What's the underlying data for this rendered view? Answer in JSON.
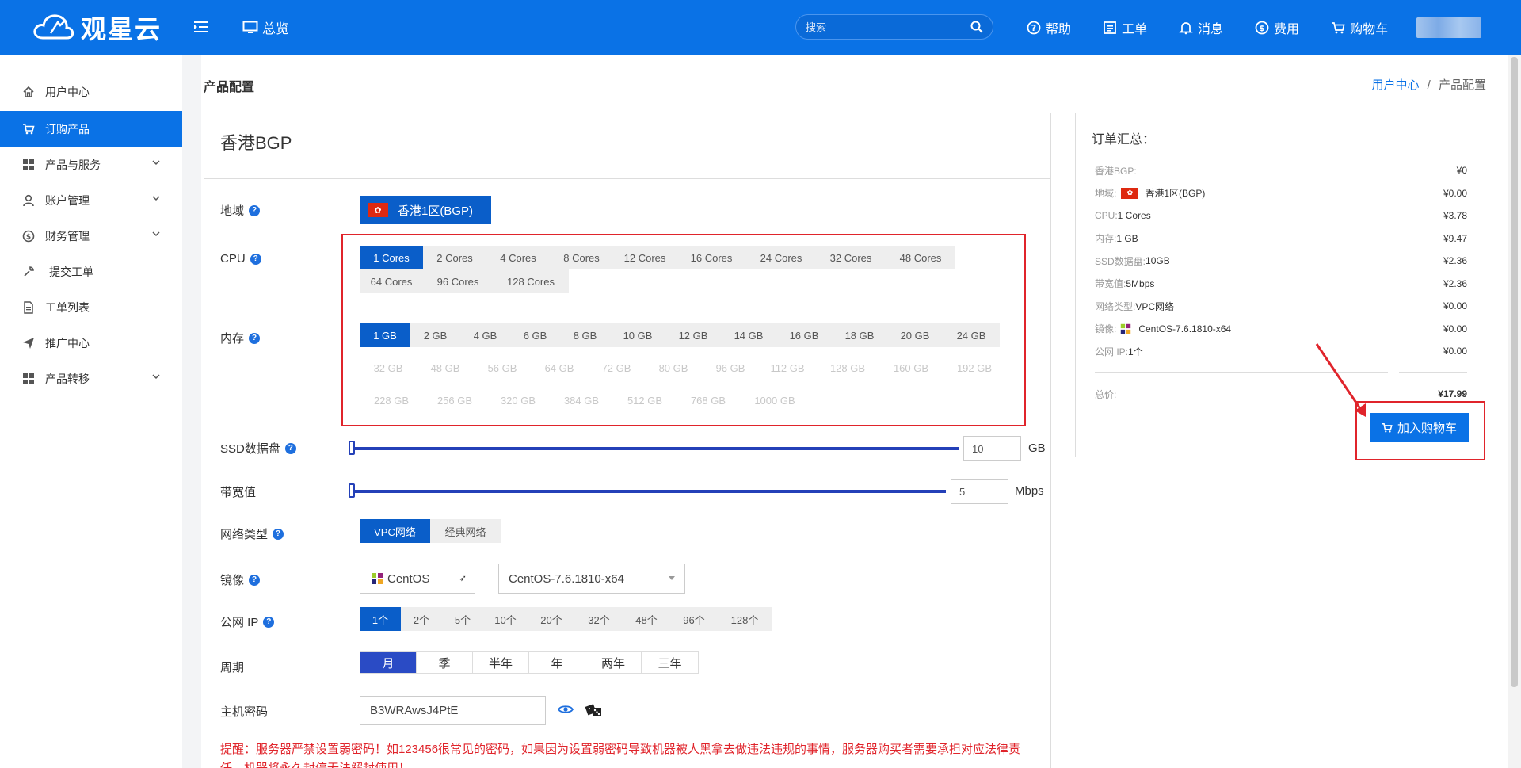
{
  "header": {
    "logo_text": "观星云",
    "overview_label": "总览",
    "search_placeholder": "搜索",
    "nav": [
      {
        "label": "帮助",
        "icon": "help-icon"
      },
      {
        "label": "工单",
        "icon": "ticket-icon"
      },
      {
        "label": "消息",
        "icon": "bell-icon"
      },
      {
        "label": "费用",
        "icon": "dollar-icon"
      },
      {
        "label": "购物车",
        "icon": "cart-icon"
      }
    ]
  },
  "sidebar": {
    "items": [
      {
        "label": "用户中心",
        "icon": "home-icon"
      },
      {
        "label": "订购产品",
        "icon": "cart-icon",
        "active": true
      },
      {
        "label": "产品与服务",
        "icon": "grid-icon",
        "expandable": true
      },
      {
        "label": "账户管理",
        "icon": "user-icon",
        "expandable": true
      },
      {
        "label": "财务管理",
        "icon": "dollar-icon",
        "expandable": true
      },
      {
        "label": "提交工单",
        "icon": "wrench-icon"
      },
      {
        "label": "工单列表",
        "icon": "document-icon"
      },
      {
        "label": "推广中心",
        "icon": "send-icon"
      },
      {
        "label": "产品转移",
        "icon": "grid-icon",
        "expandable": true
      }
    ]
  },
  "page": {
    "title": "产品配置",
    "breadcrumb": [
      "用户中心",
      "产品配置"
    ],
    "breadcrumb_sep": "/"
  },
  "config": {
    "product_name": "香港BGP",
    "labels": {
      "region": "地域",
      "cpu": "CPU",
      "memory": "内存",
      "ssd": "SSD数据盘",
      "bandwidth": "带宽值",
      "network": "网络类型",
      "image": "镜像",
      "public_ip": "公网 IP",
      "period": "周期",
      "password": "主机密码"
    },
    "region_value": "香港1区(BGP)",
    "flag_glyph": "✿",
    "cpu_options": [
      "1 Cores",
      "2 Cores",
      "4 Cores",
      "8 Cores",
      "12 Cores",
      "16 Cores",
      "24 Cores",
      "32 Cores",
      "48 Cores",
      "64 Cores",
      "96 Cores",
      "128 Cores"
    ],
    "cpu_selected": 0,
    "memory_options": [
      "1 GB",
      "2 GB",
      "4 GB",
      "6 GB",
      "8 GB",
      "10 GB",
      "12 GB",
      "14 GB",
      "16 GB",
      "18 GB",
      "20 GB",
      "24 GB"
    ],
    "memory_selected": 0,
    "memory_disabled_options": [
      "32 GB",
      "48 GB",
      "56 GB",
      "64 GB",
      "72 GB",
      "80 GB",
      "96 GB",
      "112 GB",
      "128 GB",
      "160 GB",
      "192 GB",
      "228 GB",
      "256 GB",
      "320 GB",
      "384 GB",
      "512 GB",
      "768 GB",
      "1000 GB"
    ],
    "ssd_value": "10",
    "ssd_unit": "GB",
    "bandwidth_value": "5",
    "bandwidth_unit": "Mbps",
    "network_options": [
      "VPC网络",
      "经典网络"
    ],
    "network_selected": 0,
    "image_os": "CentOS",
    "image_version": "CentOS-7.6.1810-x64",
    "ip_options": [
      "1个",
      "2个",
      "5个",
      "10个",
      "20个",
      "32个",
      "48个",
      "96个",
      "128个"
    ],
    "ip_selected": 0,
    "period_options": [
      "月",
      "季",
      "半年",
      "年",
      "两年",
      "三年"
    ],
    "period_selected": 0,
    "password_value": "B3WRAwsJ4PtE",
    "warning": "提醒：服务器严禁设置弱密码！如123456很常见的密码，如果因为设置弱密码导致机器被人黑拿去做违法违规的事情，服务器购买者需要承担对应法律责任，机器将永久封停无法解封使用！"
  },
  "summary": {
    "title": "订单汇总：",
    "rows": [
      {
        "key": "香港BGP:",
        "value": "",
        "price": "¥0"
      },
      {
        "key": "地域:",
        "value": "香港1区(BGP)",
        "price": "¥0.00",
        "flag": true
      },
      {
        "key": "CPU:",
        "value": "1 Cores",
        "price": "¥3.78"
      },
      {
        "key": "内存:",
        "value": "1 GB",
        "price": "¥9.47"
      },
      {
        "key": "SSD数据盘:",
        "value": "10GB",
        "price": "¥2.36"
      },
      {
        "key": "带宽值:",
        "value": "5Mbps",
        "price": "¥2.36"
      },
      {
        "key": "网络类型:",
        "value": "VPC网络",
        "price": "¥0.00"
      },
      {
        "key": "镜像:",
        "value": "CentOS-7.6.1810-x64",
        "price": "¥0.00",
        "os_icon": true
      },
      {
        "key": "公网 IP:",
        "value": "1个",
        "price": "¥0.00"
      }
    ],
    "total_label": "总价:",
    "total_price": "¥17.99",
    "add_to_cart": "加入购物车"
  },
  "colors": {
    "primary": "#0a72e6",
    "active_option": "#0a5ec9",
    "highlight_box": "#e0242b",
    "slider": "#2440b8",
    "warning_text": "#e0242b"
  }
}
